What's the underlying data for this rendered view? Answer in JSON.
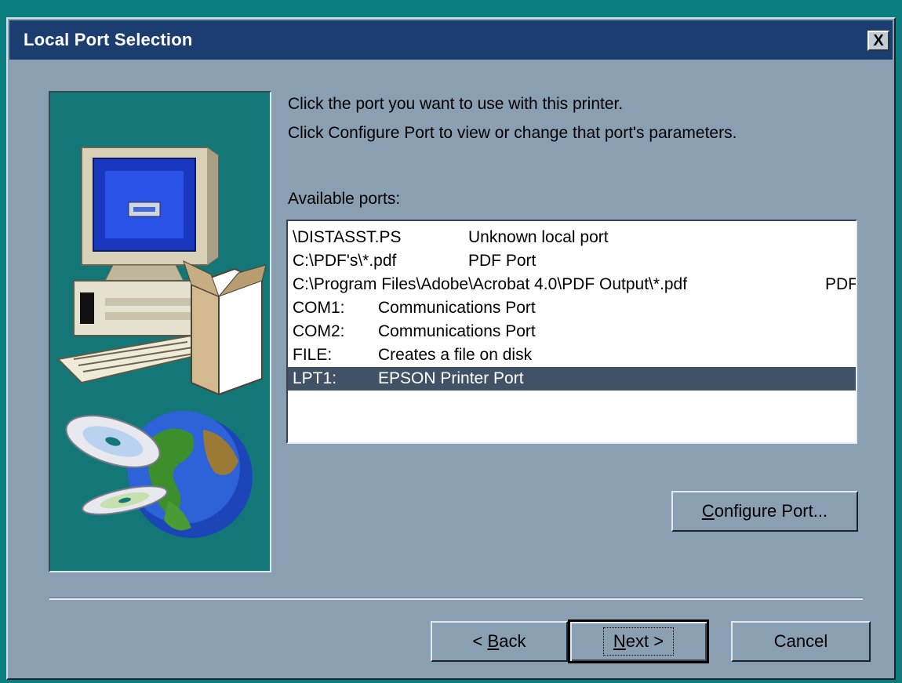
{
  "window": {
    "title": "Local Port Selection",
    "close_glyph": "X"
  },
  "instructions": {
    "line1": "Click the port you want to use with this printer.",
    "line2": "Click Configure Port to view or change that port's parameters."
  },
  "ports": {
    "label": "Available ports:",
    "selected_index": 6,
    "items": [
      {
        "name": "\\DISTASST.PS",
        "description": "Unknown local port"
      },
      {
        "name": "C:\\PDF's\\*.pdf",
        "description": "PDF Port"
      },
      {
        "name": "C:\\Program Files\\Adobe\\Acrobat 4.0\\PDF Output\\*.pdf",
        "description": "PDF Port"
      },
      {
        "name": "COM1:",
        "description": "Communications Port"
      },
      {
        "name": "COM2:",
        "description": "Communications Port"
      },
      {
        "name": "FILE:",
        "description": "Creates a file on disk"
      },
      {
        "name": "LPT1:",
        "description": "EPSON Printer Port"
      }
    ]
  },
  "buttons": {
    "configure": {
      "mnemonic": "C",
      "rest": "onfigure Port..."
    },
    "back": {
      "prefix": "< ",
      "mnemonic": "B",
      "rest": "ack"
    },
    "next": {
      "mnemonic": "N",
      "rest": "ext >"
    },
    "cancel": "Cancel"
  },
  "colors": {
    "desktop": "#0b7f7f",
    "dialog_face": "#8b9fb3",
    "title_bar": "#1c3d70",
    "selection": "#415266",
    "illustration_bg": "#137778"
  },
  "icons": [
    "close-icon",
    "computer-illustration",
    "globe-icon",
    "cd-icon",
    "box-icon"
  ]
}
